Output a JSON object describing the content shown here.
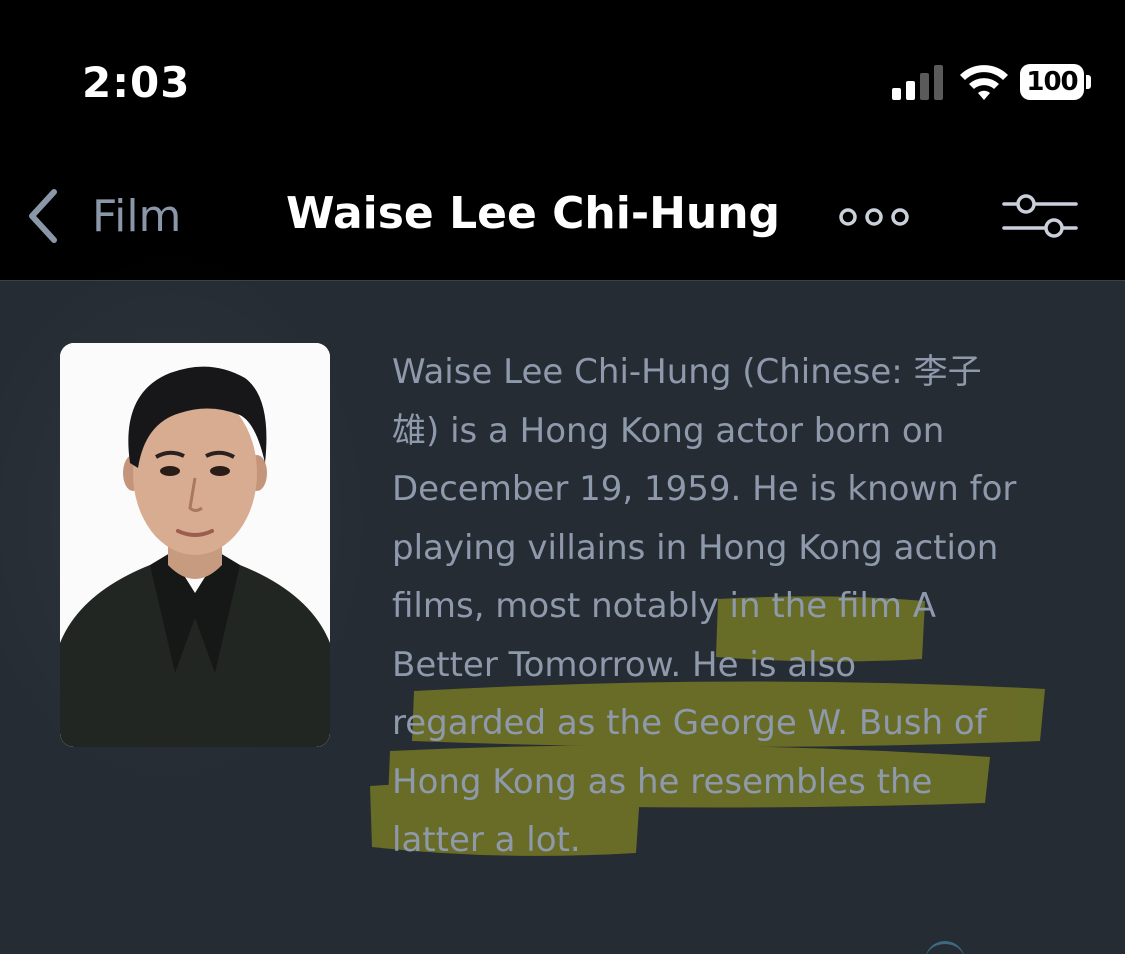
{
  "status_bar": {
    "time": "2:03",
    "battery": "100",
    "icons": [
      "signal-icon",
      "wifi-icon",
      "battery-icon"
    ]
  },
  "nav": {
    "back_label": "Film",
    "title": "Waise Lee Chi-Hung",
    "icons": [
      "chevron-left-icon",
      "more-icon",
      "filter-icon"
    ]
  },
  "article": {
    "lines": [
      "Waise Lee Chi-Hung (Chinese: 李子",
      "雄) is a Hong Kong actor born on",
      "December 19, 1959. He is known for",
      "playing villains in Hong Kong action",
      "films, most notably in the film A",
      "Better Tomorrow. He is also",
      "regarded as the George W. Bush of",
      "Hong Kong as he resembles the",
      "latter a lot."
    ]
  },
  "colors": {
    "background": "#262c34",
    "text": "#8e9aab",
    "highlight": "#c8c820",
    "nav_background": "#000000"
  }
}
